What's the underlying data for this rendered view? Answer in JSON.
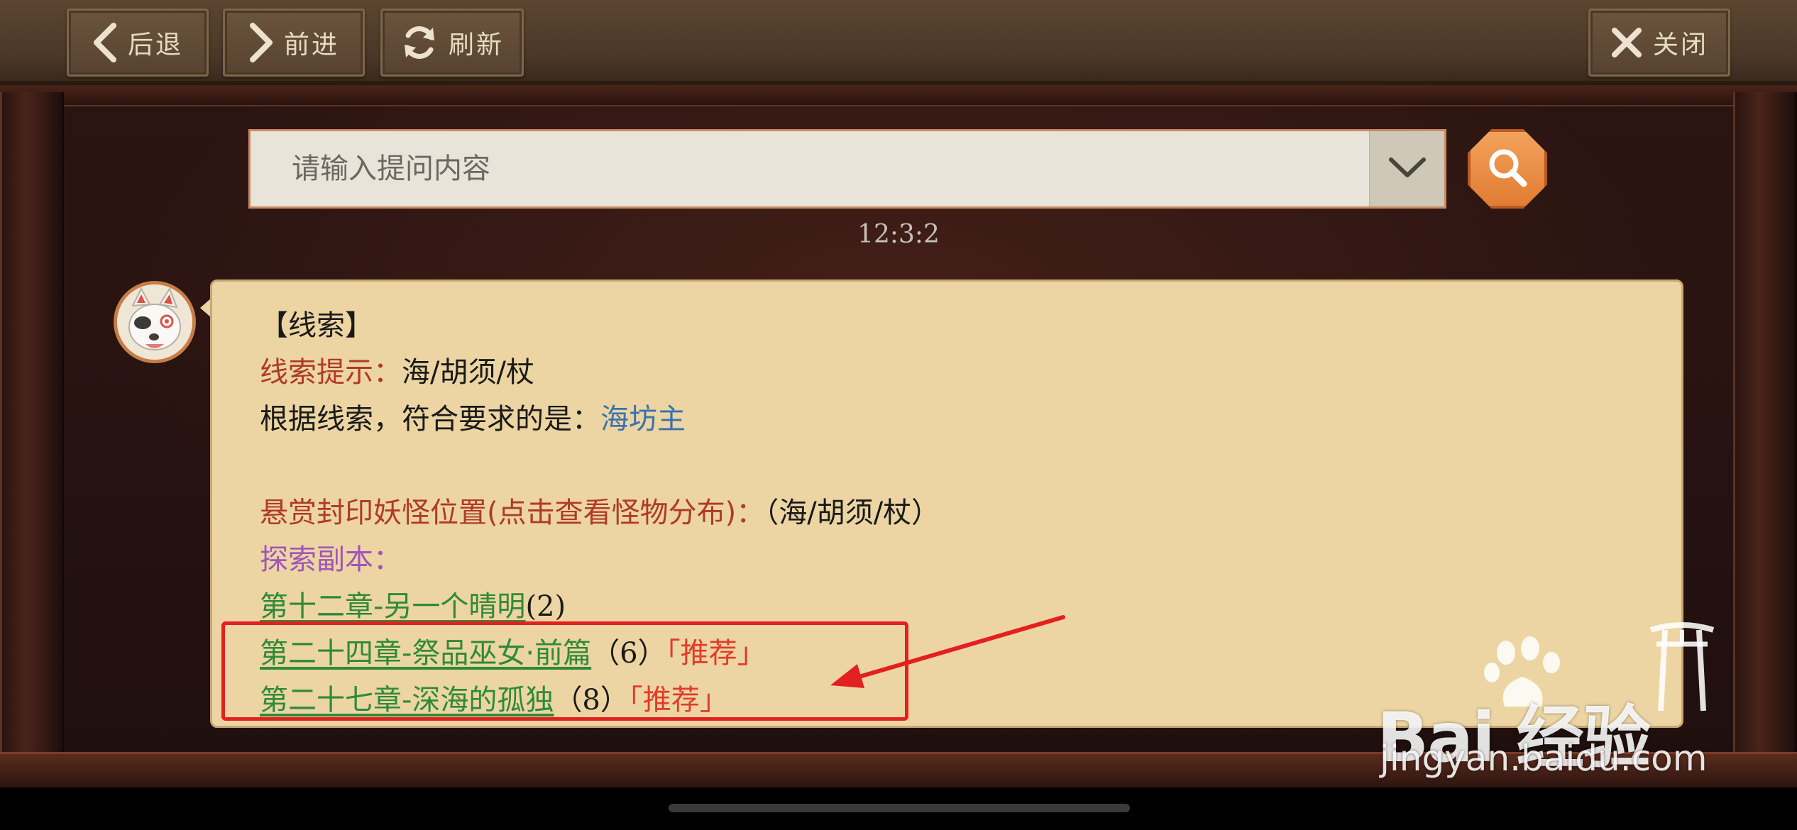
{
  "nav": {
    "back_label": "后退",
    "forward_label": "前进",
    "refresh_label": "刷新",
    "close_label": "关闭"
  },
  "search": {
    "placeholder": "请输入提问内容"
  },
  "timestamp": "12:3:2",
  "message": {
    "heading": "【线索】",
    "clue_label": "线索提示：",
    "clue_value": "海/胡须/杖",
    "answer_label": "根据线索，符合要求的是：",
    "answer_value": "海坊主",
    "bounty_label": "悬赏封印妖怪位置(点击查看怪物分布)：",
    "bounty_value": "（海/胡须/杖）",
    "explore_label": "探索副本：",
    "chapters": [
      {
        "title": "第十二章-另一个晴明",
        "count": "(2)",
        "tag": ""
      },
      {
        "title": "第二十四章-祭品巫女·前篇",
        "count": "（6）",
        "tag": "「推荐」"
      },
      {
        "title": "第二十七章-深海的孤独",
        "count": "（8）",
        "tag": "「推荐」"
      }
    ]
  },
  "watermark": {
    "logo": "Bai  经验",
    "url": "jingyan.baidu.com"
  }
}
